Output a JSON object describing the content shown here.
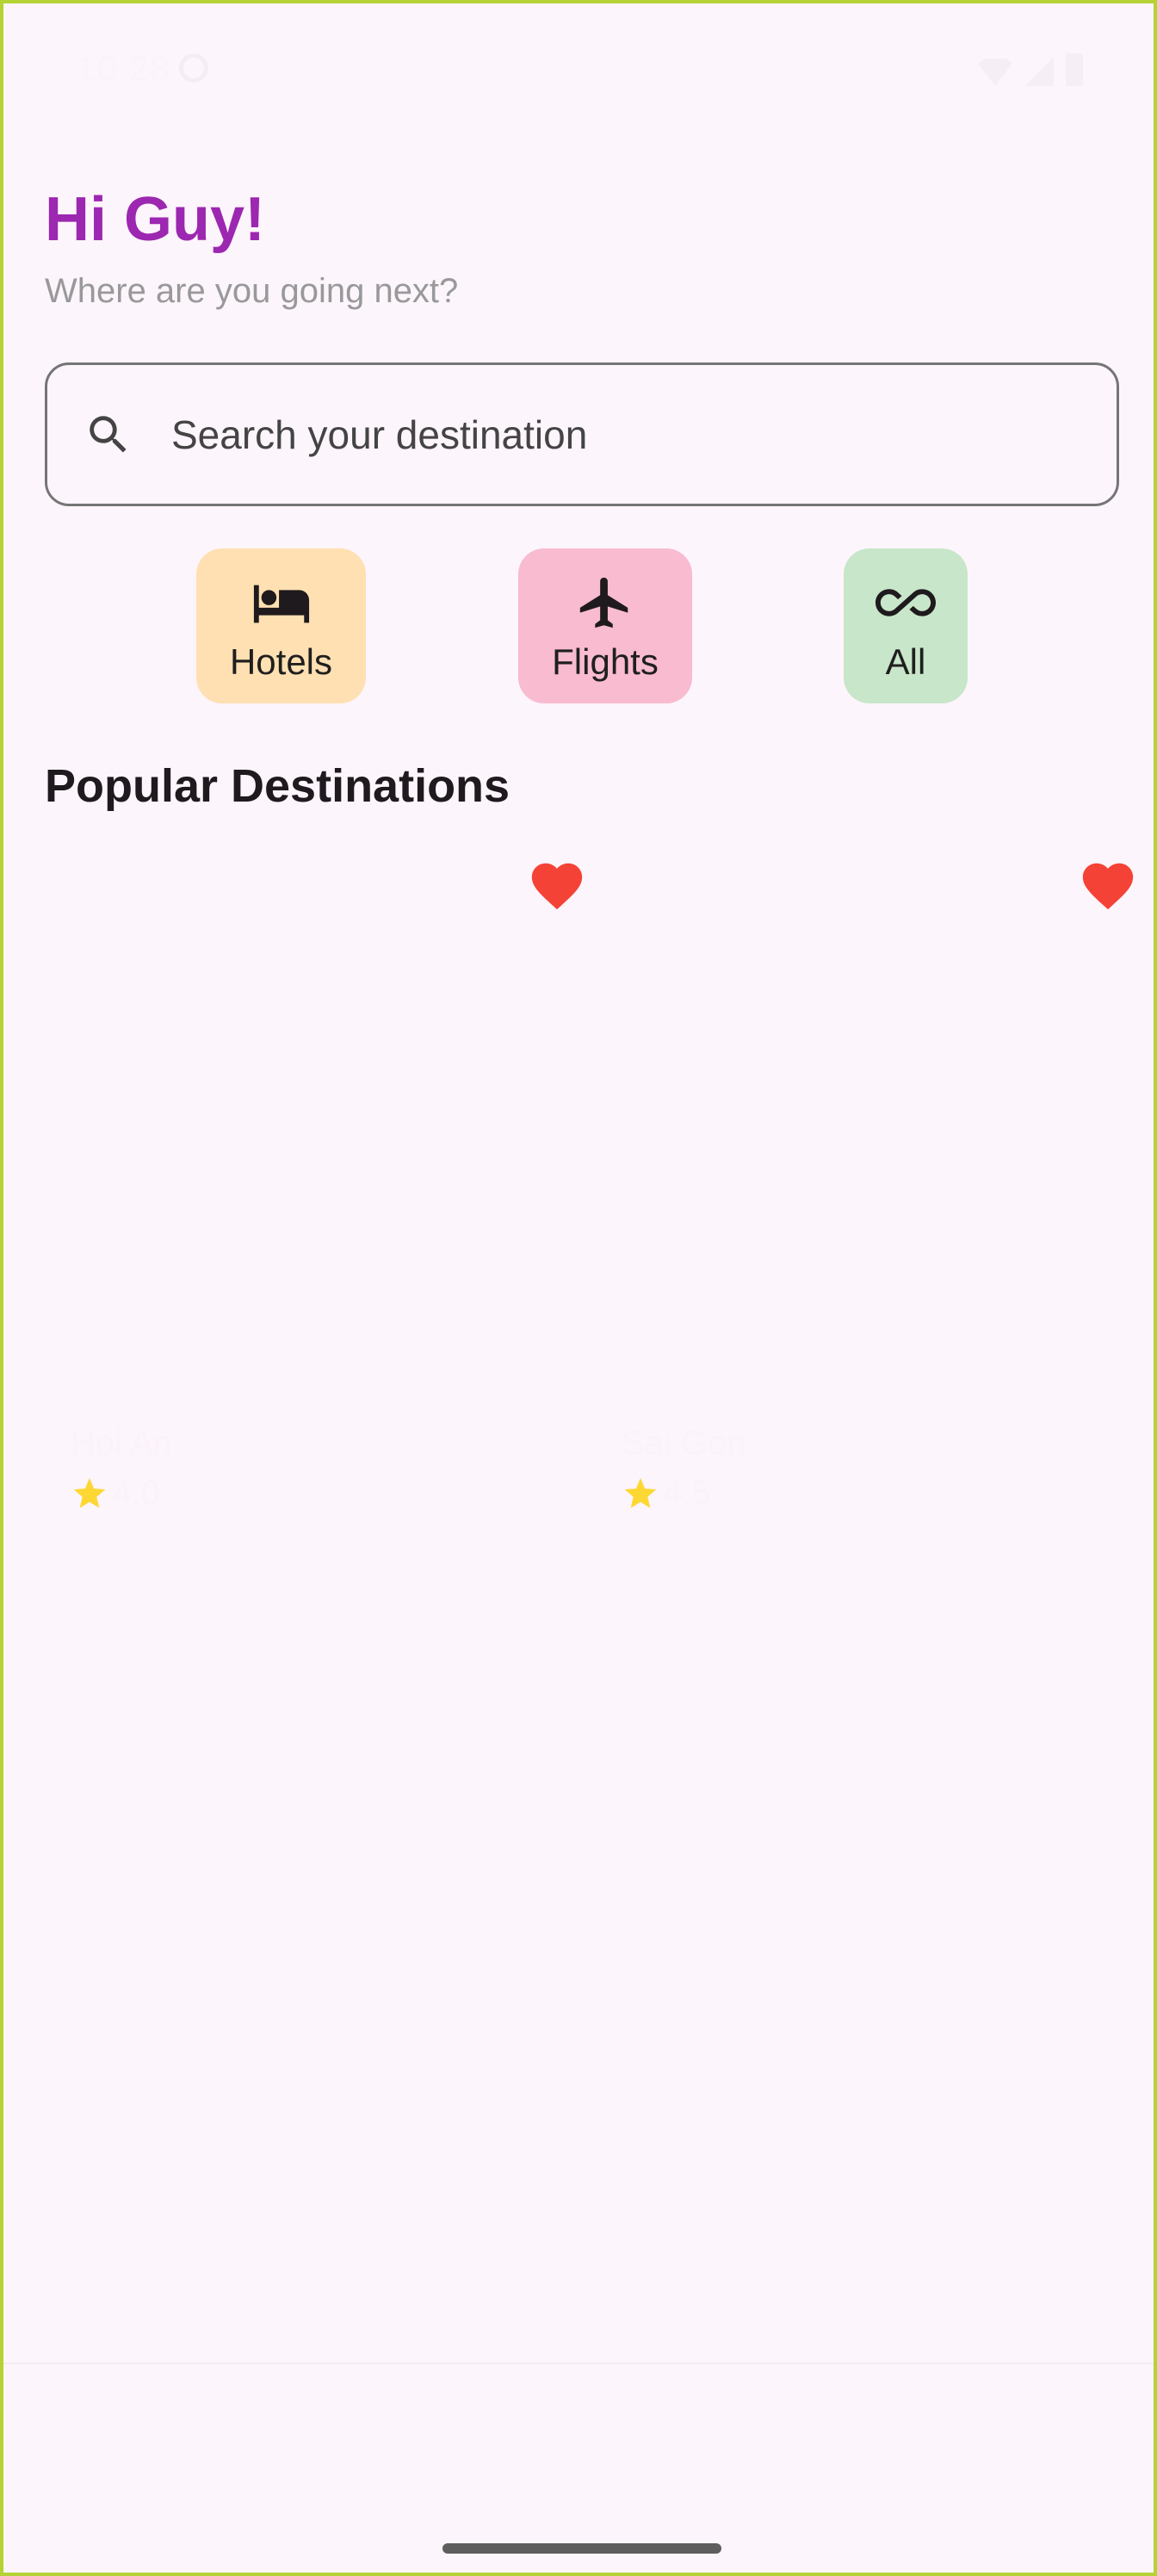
{
  "status_bar": {
    "time": "10:28"
  },
  "header": {
    "greeting": "Hi Guy!",
    "subtitle": "Where are you going next?"
  },
  "search": {
    "placeholder": "Search your destination"
  },
  "categories": [
    {
      "label": "Hotels",
      "icon": "bed-icon",
      "color": "#ffe0b2"
    },
    {
      "label": "Flights",
      "icon": "airplane-icon",
      "color": "#f8bbd0"
    },
    {
      "label": "All",
      "icon": "infinity-icon",
      "color": "#c8e6c9"
    }
  ],
  "popular": {
    "title": "Popular Destinations",
    "destinations": [
      {
        "name": "Hoi An",
        "rating": "4.0",
        "favorite": true
      },
      {
        "name": "Sai Gon",
        "rating": "4.5",
        "favorite": true
      }
    ]
  },
  "colors": {
    "accent": "#9c27b0",
    "background": "#fdf5fc",
    "heart": "#f44336",
    "star": "#fdd835"
  }
}
